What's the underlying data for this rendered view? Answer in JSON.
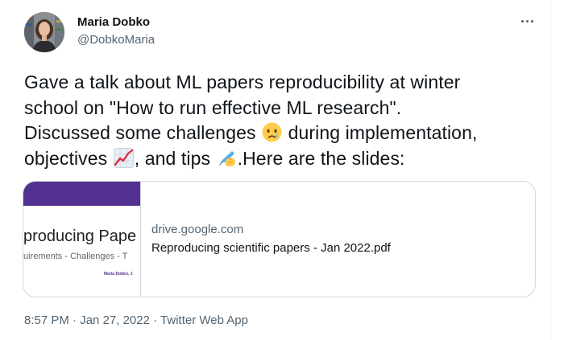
{
  "author": {
    "name": "Maria Dobko",
    "handle": "@DobkoMaria"
  },
  "tweet": {
    "lines": [
      {
        "text": "Gave a talk about ML papers reproducibility at winter"
      },
      {
        "text": "school on \"How to run effective ML research\"."
      },
      {
        "before": "Discussed some challenges ",
        "emoji": "crying-face-emoji",
        "after": " during implementation,"
      },
      {
        "before": "objectives ",
        "emoji": "chart-increasing-emoji",
        "middle": ", and tips ",
        "emoji2": "writing-hand-emoji",
        "after": ".Here are the slides:"
      }
    ]
  },
  "link_card": {
    "domain": "drive.google.com",
    "title": "Reproducing scientific papers - Jan 2022.pdf",
    "thumbnail": {
      "title": "producing Pape",
      "subtitle": "uirements - Challenges - T",
      "author": "Maria Dobko, J",
      "bar_color": "#52308f"
    }
  },
  "meta": {
    "time": "8:57 PM",
    "separator": " · ",
    "date": "Jan 27, 2022",
    "source": "Twitter Web App"
  },
  "colors": {
    "text": "#0f1419",
    "secondary": "#536471",
    "border": "#cfd9de"
  },
  "icons": {
    "more": "more-dots-icon"
  }
}
